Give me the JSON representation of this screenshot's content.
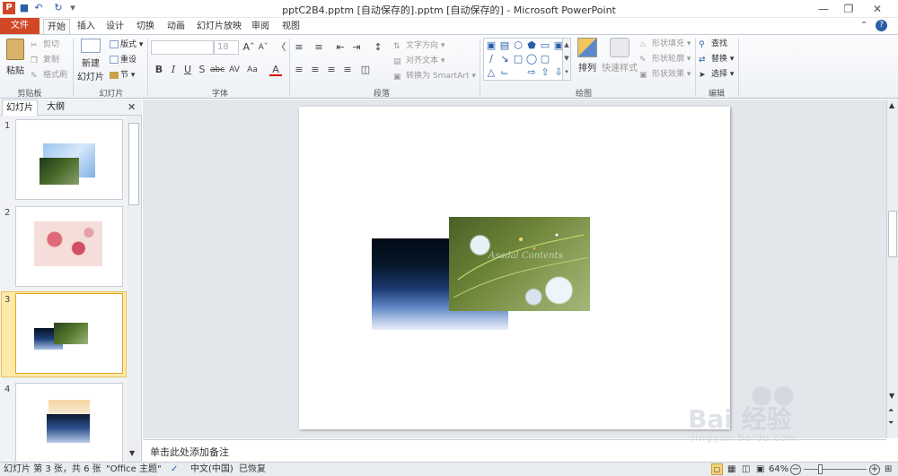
{
  "window": {
    "title": "pptC2B4.pptm [自动保存的].pptm [自动保存的] - Microsoft PowerPoint"
  },
  "tabs": [
    "文件",
    "开始",
    "插入",
    "设计",
    "切换",
    "动画",
    "幻灯片放映",
    "审阅",
    "视图"
  ],
  "ribbon": {
    "clipboard": {
      "label": "剪贴板",
      "paste": "粘贴",
      "cut": "剪切",
      "copy": "复制",
      "format_painter": "格式刷"
    },
    "slides": {
      "label": "幻灯片",
      "new_slide": "新建",
      "new_slide2": "幻灯片",
      "layout": "版式",
      "reset": "重设",
      "section": "节"
    },
    "font": {
      "label": "字体",
      "font_name": "",
      "font_size": "18"
    },
    "paragraph": {
      "label": "段落",
      "text_direction": "文字方向",
      "align_text": "对齐文本",
      "smartart": "转换为 SmartArt"
    },
    "drawing": {
      "label": "绘图",
      "arrange": "排列",
      "quick_styles": "快速样式",
      "shape_fill": "形状填充",
      "shape_outline": "形状轮廓",
      "shape_effects": "形状效果"
    },
    "editing": {
      "label": "编辑",
      "find": "查找",
      "replace": "替换",
      "select": "选择"
    }
  },
  "panel": {
    "tab_slides": "幻灯片",
    "tab_outline": "大纲",
    "slide_numbers": [
      "1",
      "2",
      "3",
      "4"
    ],
    "selected": 3
  },
  "notes": {
    "placeholder": "单击此处添加备注"
  },
  "slide_text": {
    "decor": "Asadal Contents"
  },
  "status": {
    "slide_info": "幻灯片 第 3 张，共 6 张",
    "theme": "\"Office 主题\"",
    "language": "中文(中国)",
    "recovered": "已恢复",
    "zoom": "64%"
  },
  "watermark": {
    "brand": "Bai 经验",
    "url": "jingyan.baidu.com"
  },
  "colors": {
    "file_tab": "#d24726",
    "accent": "#2a5fa8",
    "selection": "#fde9a8"
  }
}
